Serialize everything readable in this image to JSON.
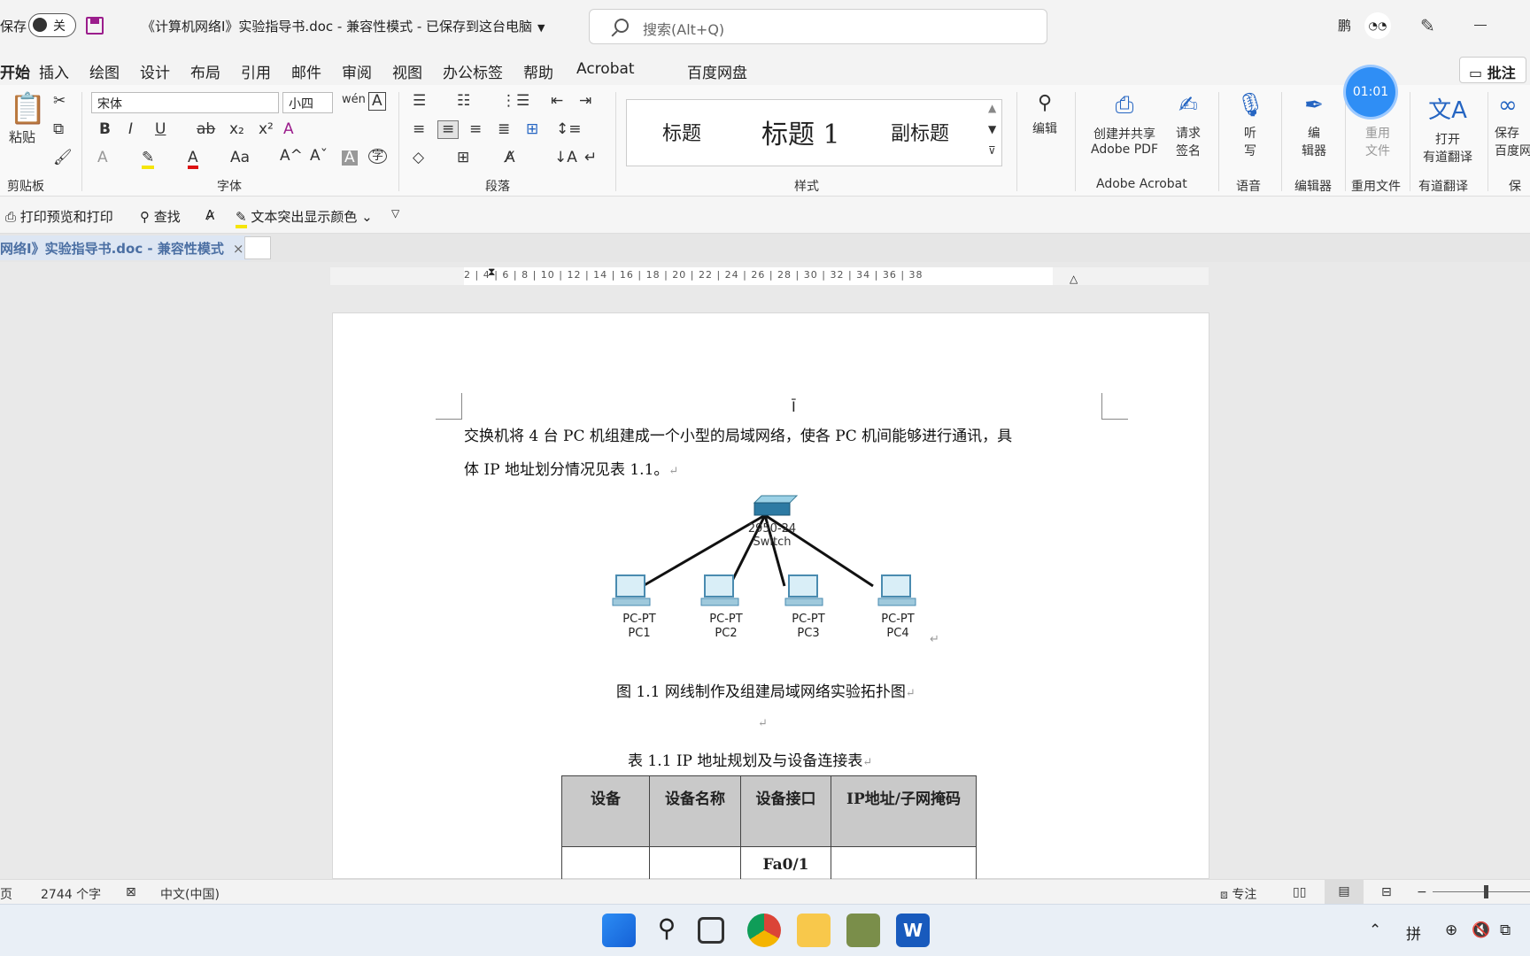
{
  "titlebar": {
    "save_label": "保存",
    "toggle_label": "关",
    "doc_title": "《计算机网络I》实验指导书.doc  -  兼容性模式  -  已保存到这台电脑",
    "search_placeholder": "搜索(Alt+Q)",
    "user_name": "鹏"
  },
  "menu": {
    "items": [
      "开始",
      "插入",
      "绘图",
      "设计",
      "布局",
      "引用",
      "邮件",
      "审阅",
      "视图",
      "办公标签",
      "帮助",
      "Acrobat",
      "百度网盘"
    ],
    "comment_button": "批注",
    "timer": "01:01"
  },
  "ribbon": {
    "clipboard": {
      "paste": "粘贴",
      "label": "剪贴板"
    },
    "font": {
      "name": "宋体",
      "size": "小四",
      "label": "字体"
    },
    "paragraph": {
      "label": "段落"
    },
    "styles": {
      "items": [
        "标题",
        "标题 1",
        "副标题"
      ],
      "label": "样式"
    },
    "edit": {
      "label": "编辑"
    },
    "acrobat": {
      "create_pdf_line1": "创建并共享",
      "create_pdf_line2": "Adobe PDF",
      "sign_line1": "请求",
      "sign_line2": "签名",
      "label": "Adobe Acrobat"
    },
    "voice": {
      "line1": "听",
      "line2": "写",
      "label": "语音"
    },
    "editor": {
      "line1": "编",
      "line2": "辑器",
      "label": "编辑器"
    },
    "reuse": {
      "line1": "重用",
      "line2": "文件",
      "label": "重用文件"
    },
    "youdao": {
      "line1": "打开",
      "line2": "有道翻译",
      "label": "有道翻译"
    },
    "baidu": {
      "line1": "保存",
      "line2": "百度网",
      "label": "保存"
    }
  },
  "qat": {
    "print_preview": "打印预览和打印",
    "find": "查找",
    "highlight": "文本突出显示颜色"
  },
  "doc_tab": {
    "label": "网络I》实验指导书.doc  -  兼容性模式"
  },
  "ruler": {
    "numbers": "2   |  4  |  6  |  8  | 10 | 12 | 14 | 16 | 18 | 20 | 22 | 24 | 26 | 28 | 30 | 32 | 34 | 36 | 38"
  },
  "document": {
    "para_line1": "交换机将 4 台 PC 机组建成一个小型的局域网络，使各 PC 机间能够进行通讯，具",
    "para_line2": "体 IP 地址划分情况见表 1.1。",
    "switch_model": "2950-24",
    "switch_name": "Switch",
    "pcs": [
      {
        "type": "PC-PT",
        "name": "PC1"
      },
      {
        "type": "PC-PT",
        "name": "PC2"
      },
      {
        "type": "PC-PT",
        "name": "PC3"
      },
      {
        "type": "PC-PT",
        "name": "PC4"
      }
    ],
    "figure_caption": "图 1.1  网线制作及组建局域网络实验拓扑图",
    "table_caption": "表 1.1   IP 地址规划及与设备连接表",
    "table": {
      "headers": [
        "设备",
        "设备名称",
        "设备接口",
        "IP地址/子网掩码"
      ],
      "rows": [
        [
          "",
          "",
          "Fa0/1",
          ""
        ]
      ]
    }
  },
  "statusbar": {
    "page": "页",
    "word_count": "2744 个字",
    "language": "中文(中国)",
    "focus": "专注"
  },
  "taskbar": {
    "ime": "拼"
  },
  "colors": {
    "accent": "#185abd",
    "timer": "#2f8ef5",
    "table_header": "#c9c9c9"
  }
}
